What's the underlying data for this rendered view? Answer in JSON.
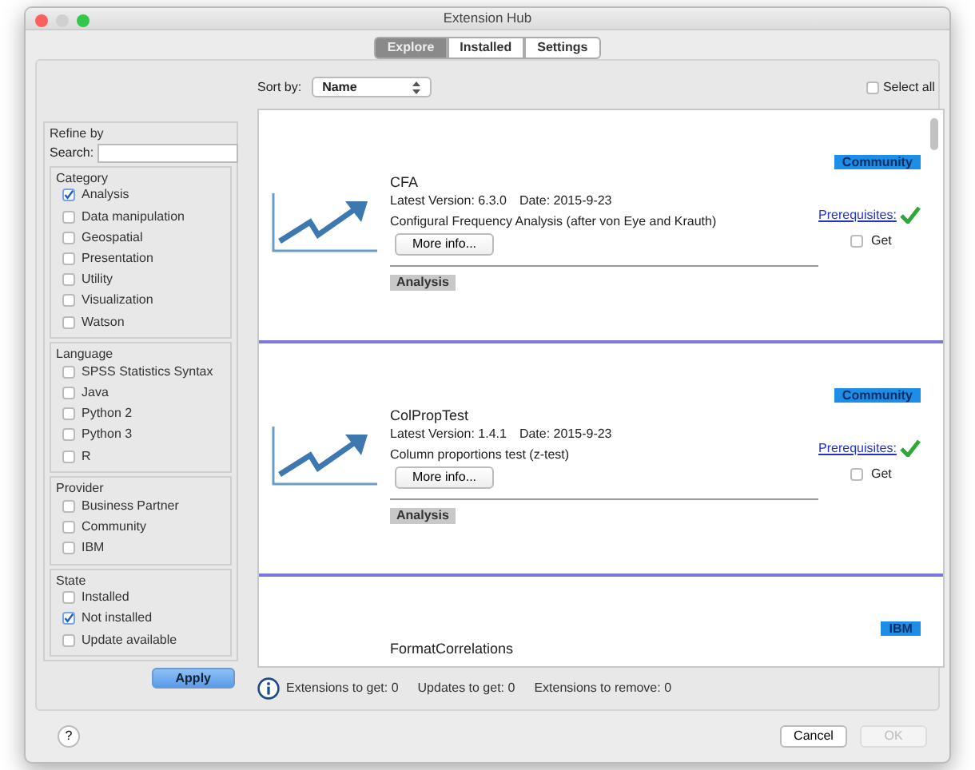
{
  "window": {
    "title": "Extension Hub"
  },
  "tabs": [
    {
      "label": "Explore",
      "selected": true
    },
    {
      "label": "Installed",
      "selected": false
    },
    {
      "label": "Settings",
      "selected": false
    }
  ],
  "sort": {
    "label": "Sort by:",
    "value": "Name"
  },
  "select_all": {
    "label": "Select all",
    "checked": false
  },
  "refine": {
    "title": "Refine by",
    "search_label": "Search:",
    "groups": [
      {
        "title": "Category",
        "options": [
          {
            "label": "Analysis",
            "checked": true
          },
          {
            "label": "Data manipulation",
            "checked": false
          },
          {
            "label": "Geospatial",
            "checked": false
          },
          {
            "label": "Presentation",
            "checked": false
          },
          {
            "label": "Utility",
            "checked": false
          },
          {
            "label": "Visualization",
            "checked": false
          },
          {
            "label": "Watson",
            "checked": false
          }
        ]
      },
      {
        "title": "Language",
        "options": [
          {
            "label": "SPSS Statistics Syntax",
            "checked": false
          },
          {
            "label": "Java",
            "checked": false
          },
          {
            "label": "Python 2",
            "checked": false
          },
          {
            "label": "Python 3",
            "checked": false
          },
          {
            "label": "R",
            "checked": false
          }
        ]
      },
      {
        "title": "Provider",
        "options": [
          {
            "label": "Business Partner",
            "checked": false
          },
          {
            "label": "Community",
            "checked": false
          },
          {
            "label": "IBM",
            "checked": false
          }
        ]
      },
      {
        "title": "State",
        "options": [
          {
            "label": "Installed",
            "checked": false
          },
          {
            "label": "Not installed",
            "checked": true
          },
          {
            "label": "Update available",
            "checked": false
          }
        ]
      }
    ]
  },
  "apply_button": "Apply",
  "extensions": [
    {
      "name": "CFA",
      "version": "Latest Version: 6.3.0",
      "date": "Date: 2015-9-23",
      "description": "Configural Frequency Analysis (after von Eye and Krauth)",
      "more_button": "More info...",
      "tags": [
        "Analysis"
      ],
      "provider": "Community",
      "prerequisites": "Prerequisites:",
      "prerequisites_met": true,
      "get": {
        "label": "Get",
        "checked": false
      }
    },
    {
      "name": "ColPropTest",
      "version": "Latest Version: 1.4.1",
      "date": "Date: 2015-9-23",
      "description": "Column proportions test (z-test)",
      "more_button": "More info...",
      "tags": [
        "Analysis"
      ],
      "provider": "Community",
      "prerequisites": "Prerequisites:",
      "prerequisites_met": true,
      "get": {
        "label": "Get",
        "checked": false
      }
    },
    {
      "name": "FormatCorrelations",
      "provider": "IBM"
    }
  ],
  "status": [
    "Extensions to get: 0",
    "Updates to get: 0",
    "Extensions to remove: 0"
  ],
  "help_button": "?",
  "buttons": [
    {
      "label": "Cancel",
      "disabled": false
    },
    {
      "label": "OK",
      "disabled": true
    }
  ]
}
